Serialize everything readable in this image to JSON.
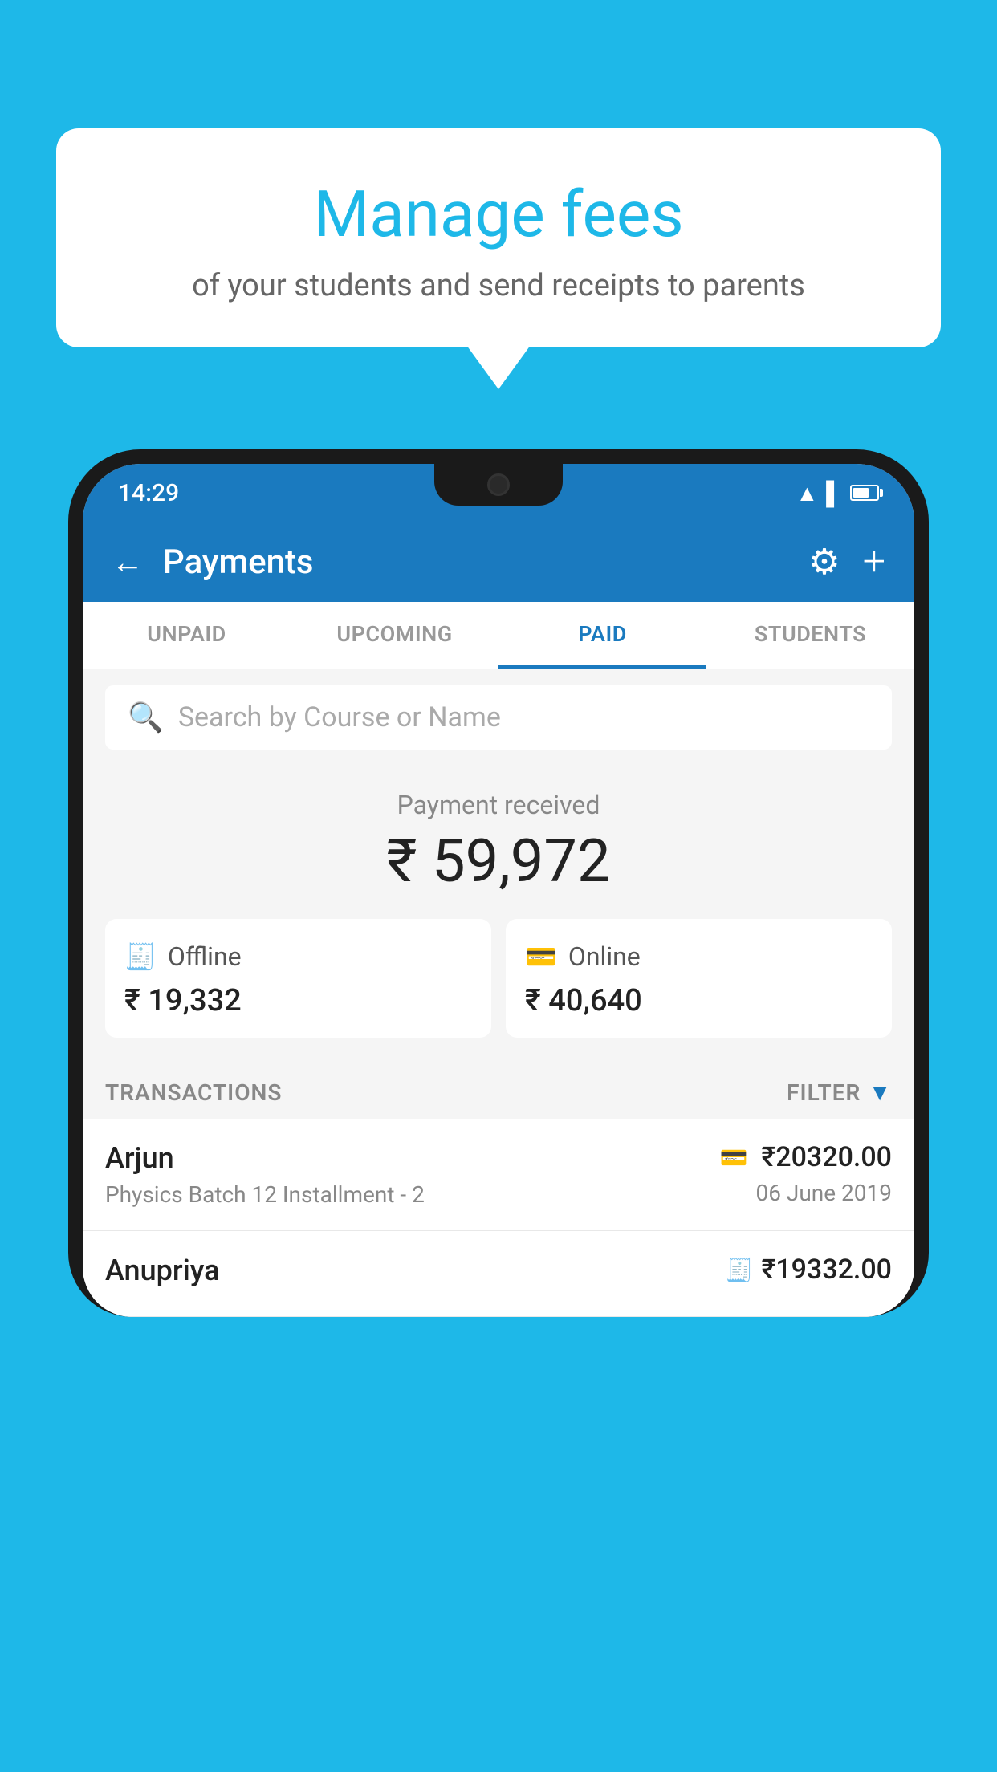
{
  "background_color": "#1eb8e8",
  "speech_bubble": {
    "title": "Manage fees",
    "subtitle": "of your students and send receipts to parents"
  },
  "status_bar": {
    "time": "14:29"
  },
  "app_bar": {
    "title": "Payments",
    "back_label": "←",
    "gear_label": "⚙",
    "plus_label": "+"
  },
  "tabs": [
    {
      "label": "UNPAID",
      "active": false
    },
    {
      "label": "UPCOMING",
      "active": false
    },
    {
      "label": "PAID",
      "active": true
    },
    {
      "label": "STUDENTS",
      "active": false
    }
  ],
  "search": {
    "placeholder": "Search by Course or Name"
  },
  "payment_summary": {
    "label": "Payment received",
    "amount": "₹ 59,972",
    "cards": [
      {
        "type": "Offline",
        "amount": "₹ 19,332",
        "icon": "💳"
      },
      {
        "type": "Online",
        "amount": "₹ 40,640",
        "icon": "💳"
      }
    ]
  },
  "transactions_section": {
    "label": "TRANSACTIONS",
    "filter_label": "FILTER"
  },
  "transactions": [
    {
      "name": "Arjun",
      "details": "Physics Batch 12 Installment - 2",
      "amount": "₹20320.00",
      "date": "06 June 2019",
      "pay_type": "online"
    },
    {
      "name": "Anupriya",
      "details": "",
      "amount": "₹19332.00",
      "date": "",
      "pay_type": "offline"
    }
  ]
}
